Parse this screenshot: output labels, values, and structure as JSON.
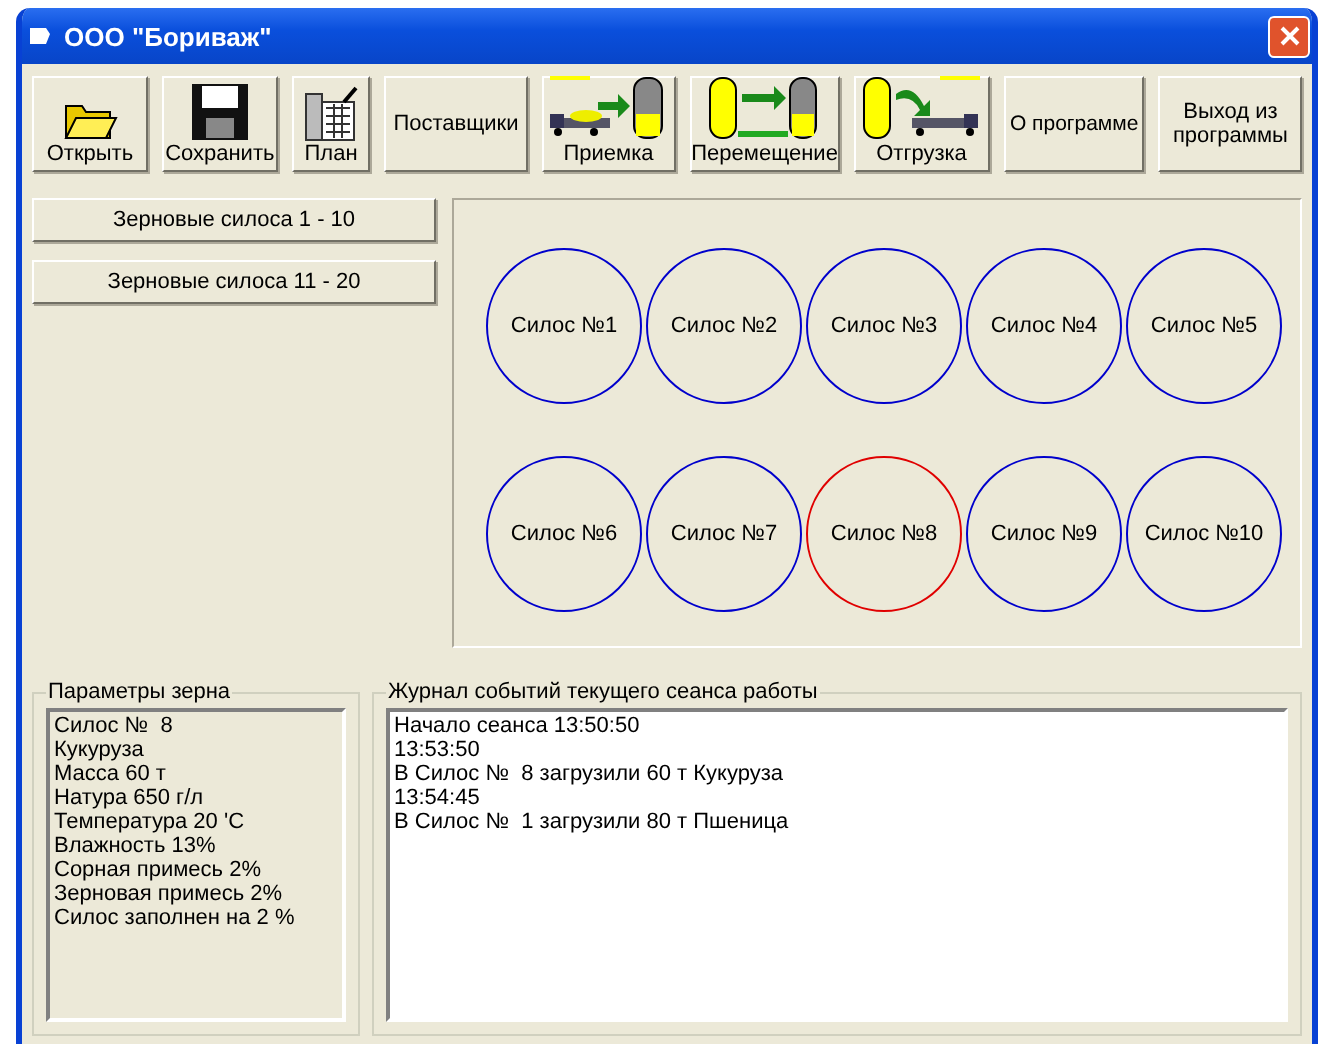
{
  "window": {
    "title": "ООО \"Бориваж\""
  },
  "toolbar": [
    {
      "label": "Открыть",
      "kind": "open"
    },
    {
      "label": "Сохранить",
      "kind": "save"
    },
    {
      "label": "План",
      "kind": "plan"
    },
    {
      "label": "Поставщики",
      "kind": "text"
    },
    {
      "label": "Приемка",
      "kind": "receive"
    },
    {
      "label": "Перемещение",
      "kind": "move"
    },
    {
      "label": "Отгрузка",
      "kind": "ship"
    },
    {
      "label": "О программе",
      "kind": "text"
    },
    {
      "label": "Выход из программы",
      "kind": "text"
    }
  ],
  "silo_groups": [
    "Зерновые силоса 1 - 10",
    "Зерновые силоса 11 - 20"
  ],
  "silos": [
    {
      "label": "Силос №1",
      "selected": false
    },
    {
      "label": "Силос №2",
      "selected": false
    },
    {
      "label": "Силос №3",
      "selected": false
    },
    {
      "label": "Силос №4",
      "selected": false
    },
    {
      "label": "Силос №5",
      "selected": false
    },
    {
      "label": "Силос №6",
      "selected": false
    },
    {
      "label": "Силос №7",
      "selected": false
    },
    {
      "label": "Силос №8",
      "selected": true
    },
    {
      "label": "Силос №9",
      "selected": false
    },
    {
      "label": "Силос №10",
      "selected": false
    }
  ],
  "grain_params": {
    "title": "Параметры зерна",
    "lines": [
      "Силос №  8",
      "Кукуруза",
      "Масса 60 т",
      "Натура 650 г/л",
      "Температура 20 'С",
      "Влажность 13%",
      "Сорная примесь 2%",
      "Зерновая примесь 2%",
      "Силос заполнен на 2 %"
    ]
  },
  "journal": {
    "title": "Журнал событий текущего сеанса работы",
    "lines": [
      "Начало сеанса 13:50:50",
      "13:53:50",
      "В Силос №  8 загрузили 60 т Кукуруза",
      "13:54:45",
      "В Силос №  1 загрузили 80 т Пшеница"
    ]
  }
}
